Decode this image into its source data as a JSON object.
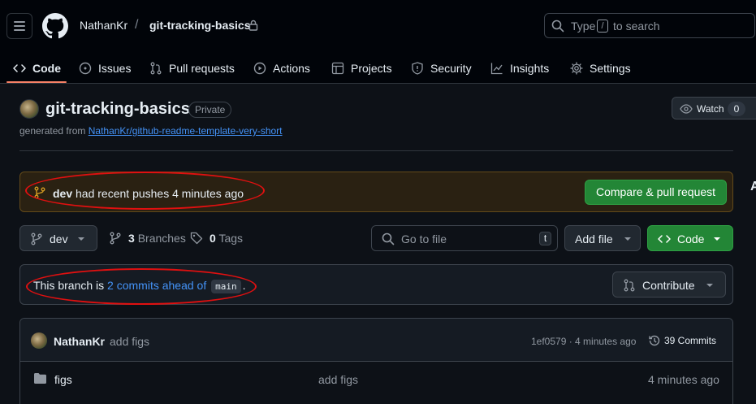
{
  "header": {
    "owner": "NathanKr",
    "separator": "/",
    "repo": "git-tracking-basics",
    "search": {
      "prefix": "Type",
      "key": "/",
      "suffix": "to search"
    }
  },
  "nav": {
    "tabs": [
      {
        "label": "Code",
        "icon": "code-icon",
        "active": true
      },
      {
        "label": "Issues",
        "icon": "issue-icon"
      },
      {
        "label": "Pull requests",
        "icon": "pull-request-icon"
      },
      {
        "label": "Actions",
        "icon": "play-icon"
      },
      {
        "label": "Projects",
        "icon": "table-icon"
      },
      {
        "label": "Security",
        "icon": "shield-icon"
      },
      {
        "label": "Insights",
        "icon": "graph-icon"
      },
      {
        "label": "Settings",
        "icon": "gear-icon"
      }
    ]
  },
  "repo": {
    "title": "git-tracking-basics",
    "visibility": "Private",
    "generated_prefix": "generated from",
    "template_link": "NathanKr/github-readme-template-very-short",
    "watch_label": "Watch",
    "watch_count": "0"
  },
  "push_banner": {
    "branch": "dev",
    "text": "had recent pushes 4 minutes ago",
    "button": "Compare & pull request"
  },
  "toolbar": {
    "branch": "dev",
    "branches_count": "3",
    "branches_label": "Branches",
    "tags_count": "0",
    "tags_label": "Tags",
    "goto_placeholder": "Go to file",
    "goto_key": "t",
    "add_file": "Add file",
    "code": "Code"
  },
  "ahead": {
    "prefix": "This branch is",
    "link": "2 commits ahead of",
    "base": "main",
    "suffix": ".",
    "contribute": "Contribute"
  },
  "latest_commit": {
    "author": "NathanKr",
    "message": "add figs",
    "meta": "1ef0579 · 4 minutes ago",
    "commits": "39 Commits"
  },
  "files": [
    {
      "name": "figs",
      "type": "folder",
      "commit": "add figs",
      "age": "4 minutes ago"
    }
  ],
  "colors": {
    "background": "#0d1117",
    "accent_green": "#238636",
    "link_blue": "#4493f8",
    "annotation_red": "#e01010",
    "tab_underline": "#f78166"
  }
}
